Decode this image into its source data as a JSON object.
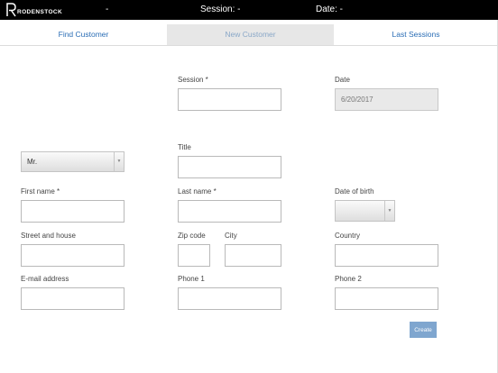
{
  "topbar": {
    "brand": "RODENSTOCK",
    "dash": "-",
    "session": "Session: -",
    "date": "Date: -"
  },
  "tabs": [
    {
      "label": "Find Customer"
    },
    {
      "label": "New Customer",
      "active": true
    },
    {
      "label": "Last Sessions"
    }
  ],
  "form": {
    "session_label": "Session *",
    "session_value": "",
    "date_label": "Date",
    "date_value": "6/20/2017",
    "salutation_value": "Mr.",
    "title_label": "Title",
    "firstname_label": "First name *",
    "lastname_label": "Last name *",
    "dob_label": "Date of birth",
    "dob_value": "",
    "street_label": "Street and house",
    "zip_label": "Zip code",
    "city_label": "City",
    "country_label": "Country",
    "email_label": "E-mail address",
    "phone1_label": "Phone 1",
    "phone2_label": "Phone 2",
    "create_label": "Create"
  },
  "colors": {
    "topbar": "#000000",
    "tab_text": "#2a6db5",
    "button": "#7fa6cf"
  }
}
